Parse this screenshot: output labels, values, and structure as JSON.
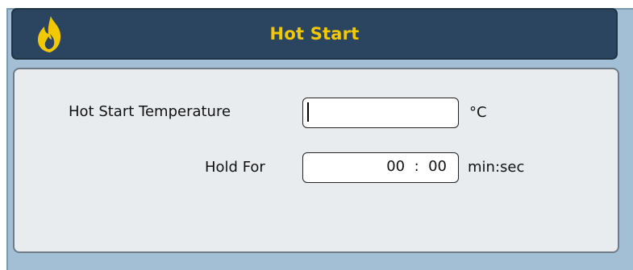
{
  "dialog": {
    "title": "Hot Start",
    "icon": "fire-icon",
    "accent_color": "#f2c800",
    "header_color": "#2b4560"
  },
  "fields": {
    "temperature": {
      "label": "Hot Start Temperature",
      "value": "",
      "unit": "°C"
    },
    "hold_for": {
      "label": "Hold For",
      "value": "00  :  00",
      "unit": "min:sec"
    }
  }
}
